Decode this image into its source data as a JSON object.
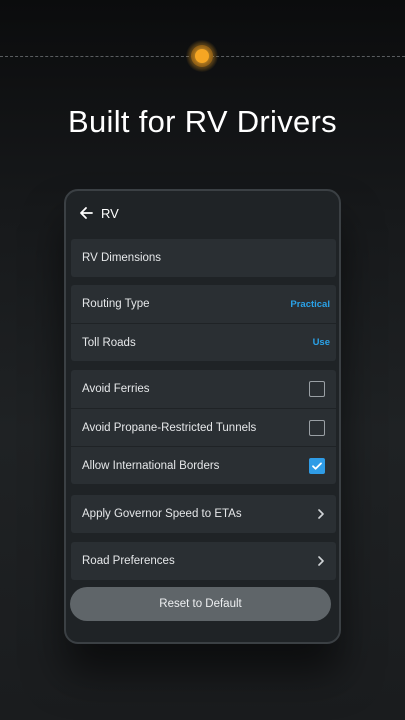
{
  "headline": "Built for RV Drivers",
  "screen": {
    "title": "RV",
    "sections": {
      "dimensions": {
        "label": "RV Dimensions"
      },
      "routing_type": {
        "label": "Routing Type",
        "value": "Practical"
      },
      "toll_roads": {
        "label": "Toll Roads",
        "value": "Use"
      },
      "avoid_ferries": {
        "label": "Avoid Ferries",
        "checked": false
      },
      "avoid_propane": {
        "label": "Avoid Propane-Restricted Tunnels",
        "checked": false
      },
      "allow_borders": {
        "label": "Allow International Borders",
        "checked": true
      },
      "governor": {
        "label": "Apply Governor Speed to ETAs"
      },
      "road_prefs": {
        "label": "Road Preferences"
      }
    },
    "reset_label": "Reset to Default"
  },
  "colors": {
    "accent": "#2aa2e8",
    "checkbox_checked": "#2f9ce6",
    "indicator": "#f6a623"
  },
  "icons": [
    "back-arrow-icon",
    "checkmark-icon",
    "chevron-right-icon"
  ]
}
